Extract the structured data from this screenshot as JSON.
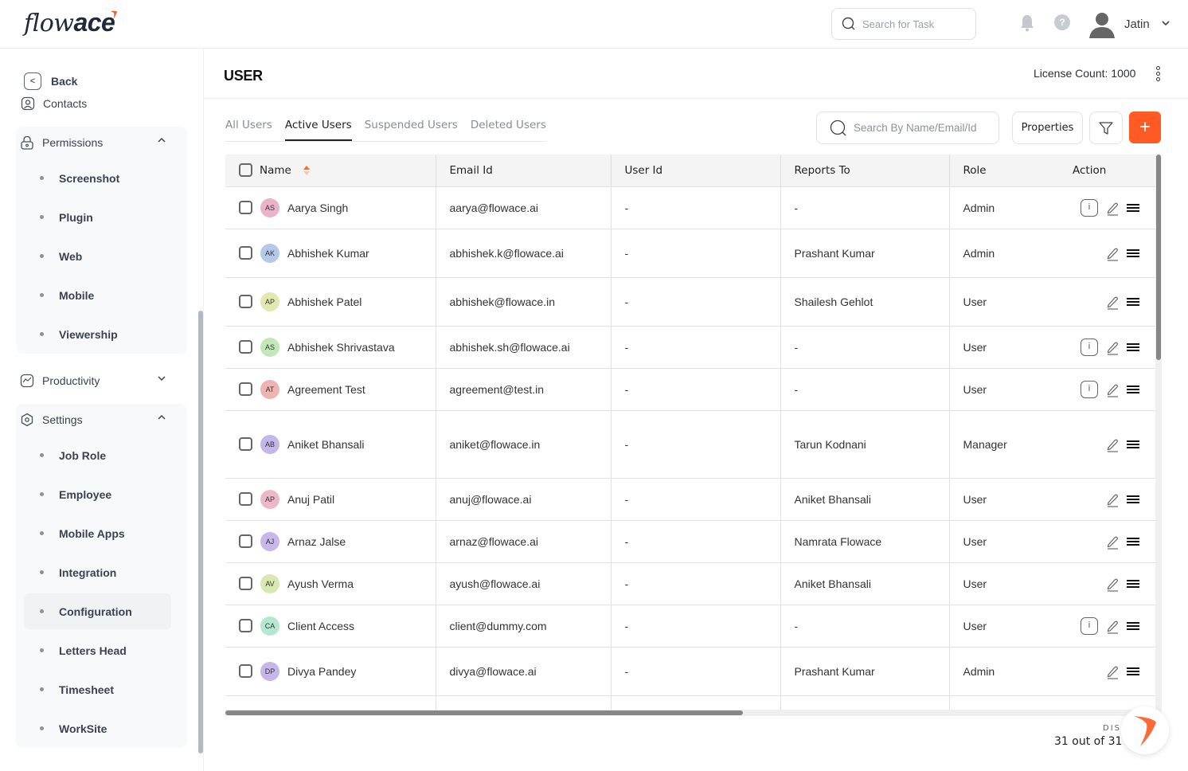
{
  "app": {
    "logo_thin": "flow",
    "logo_bold": "ace",
    "brand_color": "#fd5a24"
  },
  "topbar": {
    "task_search_placeholder": "Search for Task",
    "user_name": "Jatin"
  },
  "sidebar": {
    "back_label": "Back",
    "contacts_label": "Contacts",
    "permissions": {
      "label": "Permissions",
      "items": [
        "Screenshot",
        "Plugin",
        "Web",
        "Mobile",
        "Viewership"
      ]
    },
    "productivity": {
      "label": "Productivity"
    },
    "settings": {
      "label": "Settings",
      "items": [
        "Job Role",
        "Employee",
        "Mobile Apps",
        "Integration",
        "Configuration",
        "Letters Head",
        "Timesheet",
        "WorkSite"
      ],
      "active": "Configuration"
    }
  },
  "page": {
    "title": "USER",
    "license": "License Count: 1000",
    "tabs": [
      "All Users",
      "Active Users",
      "Suspended Users",
      "Deleted Users"
    ],
    "active_tab": "Active Users",
    "search_placeholder": "Search By Name/Email/Id",
    "properties_label": "Properties",
    "add_label": "+"
  },
  "table": {
    "columns": [
      "Name",
      "Email Id",
      "User Id",
      "Reports To",
      "Role",
      "Action"
    ],
    "rows": [
      {
        "initials": "AS",
        "color": "#e9b3c8",
        "name": "Aarya Singh",
        "email": "aarya@flowace.ai",
        "user_id": "-",
        "reports_to": "-",
        "role": "Admin",
        "info": true
      },
      {
        "initials": "AK",
        "color": "#b4c8ea",
        "name": "Abhishek Kumar",
        "email": "abhishek.k@flowace.ai",
        "user_id": "-",
        "reports_to": "Prashant Kumar",
        "role": "Admin",
        "info": false
      },
      {
        "initials": "AP",
        "color": "#e3e8b0",
        "name": "Abhishek Patel",
        "email": "abhishek@flowace.in",
        "user_id": "-",
        "reports_to": "Shailesh Gehlot",
        "role": "User",
        "info": false
      },
      {
        "initials": "AS",
        "color": "#c3e8b8",
        "name": "Abhishek Shrivastava",
        "email": "abhishek.sh@flowace.ai",
        "user_id": "-",
        "reports_to": "-",
        "role": "User",
        "info": true
      },
      {
        "initials": "AT",
        "color": "#edb5b2",
        "name": "Agreement Test",
        "email": "agreement@test.in",
        "user_id": "-",
        "reports_to": "-",
        "role": "User",
        "info": true
      },
      {
        "initials": "AB",
        "color": "#c3b6ea",
        "name": "Aniket Bhansali",
        "email": "aniket@flowace.in",
        "user_id": "-",
        "reports_to": "Tarun Kodnani",
        "role": "Manager",
        "info": false
      },
      {
        "initials": "AP",
        "color": "#edb8c6",
        "name": "Anuj Patil",
        "email": "anuj@flowace.ai",
        "user_id": "-",
        "reports_to": "Aniket Bhansali",
        "role": "User",
        "info": false
      },
      {
        "initials": "AJ",
        "color": "#c9b6ea",
        "name": "Arnaz Jalse",
        "email": "arnaz@flowace.ai",
        "user_id": "-",
        "reports_to": "Namrata Flowace",
        "role": "User",
        "info": false
      },
      {
        "initials": "AV",
        "color": "#d8e8b0",
        "name": "Ayush Verma",
        "email": "ayush@flowace.ai",
        "user_id": "-",
        "reports_to": "Aniket Bhansali",
        "role": "User",
        "info": false
      },
      {
        "initials": "CA",
        "color": "#b4e8d0",
        "name": "Client Access",
        "email": "client@dummy.com",
        "user_id": "-",
        "reports_to": "-",
        "role": "User",
        "info": true
      },
      {
        "initials": "DP",
        "color": "#c6b6ea",
        "name": "Divya Pandey",
        "email": "divya@flowace.ai",
        "user_id": "-",
        "reports_to": "Prashant Kumar",
        "role": "Admin",
        "info": false
      }
    ]
  },
  "footer": {
    "display_label": "DISP",
    "count": "31 out of 31"
  }
}
